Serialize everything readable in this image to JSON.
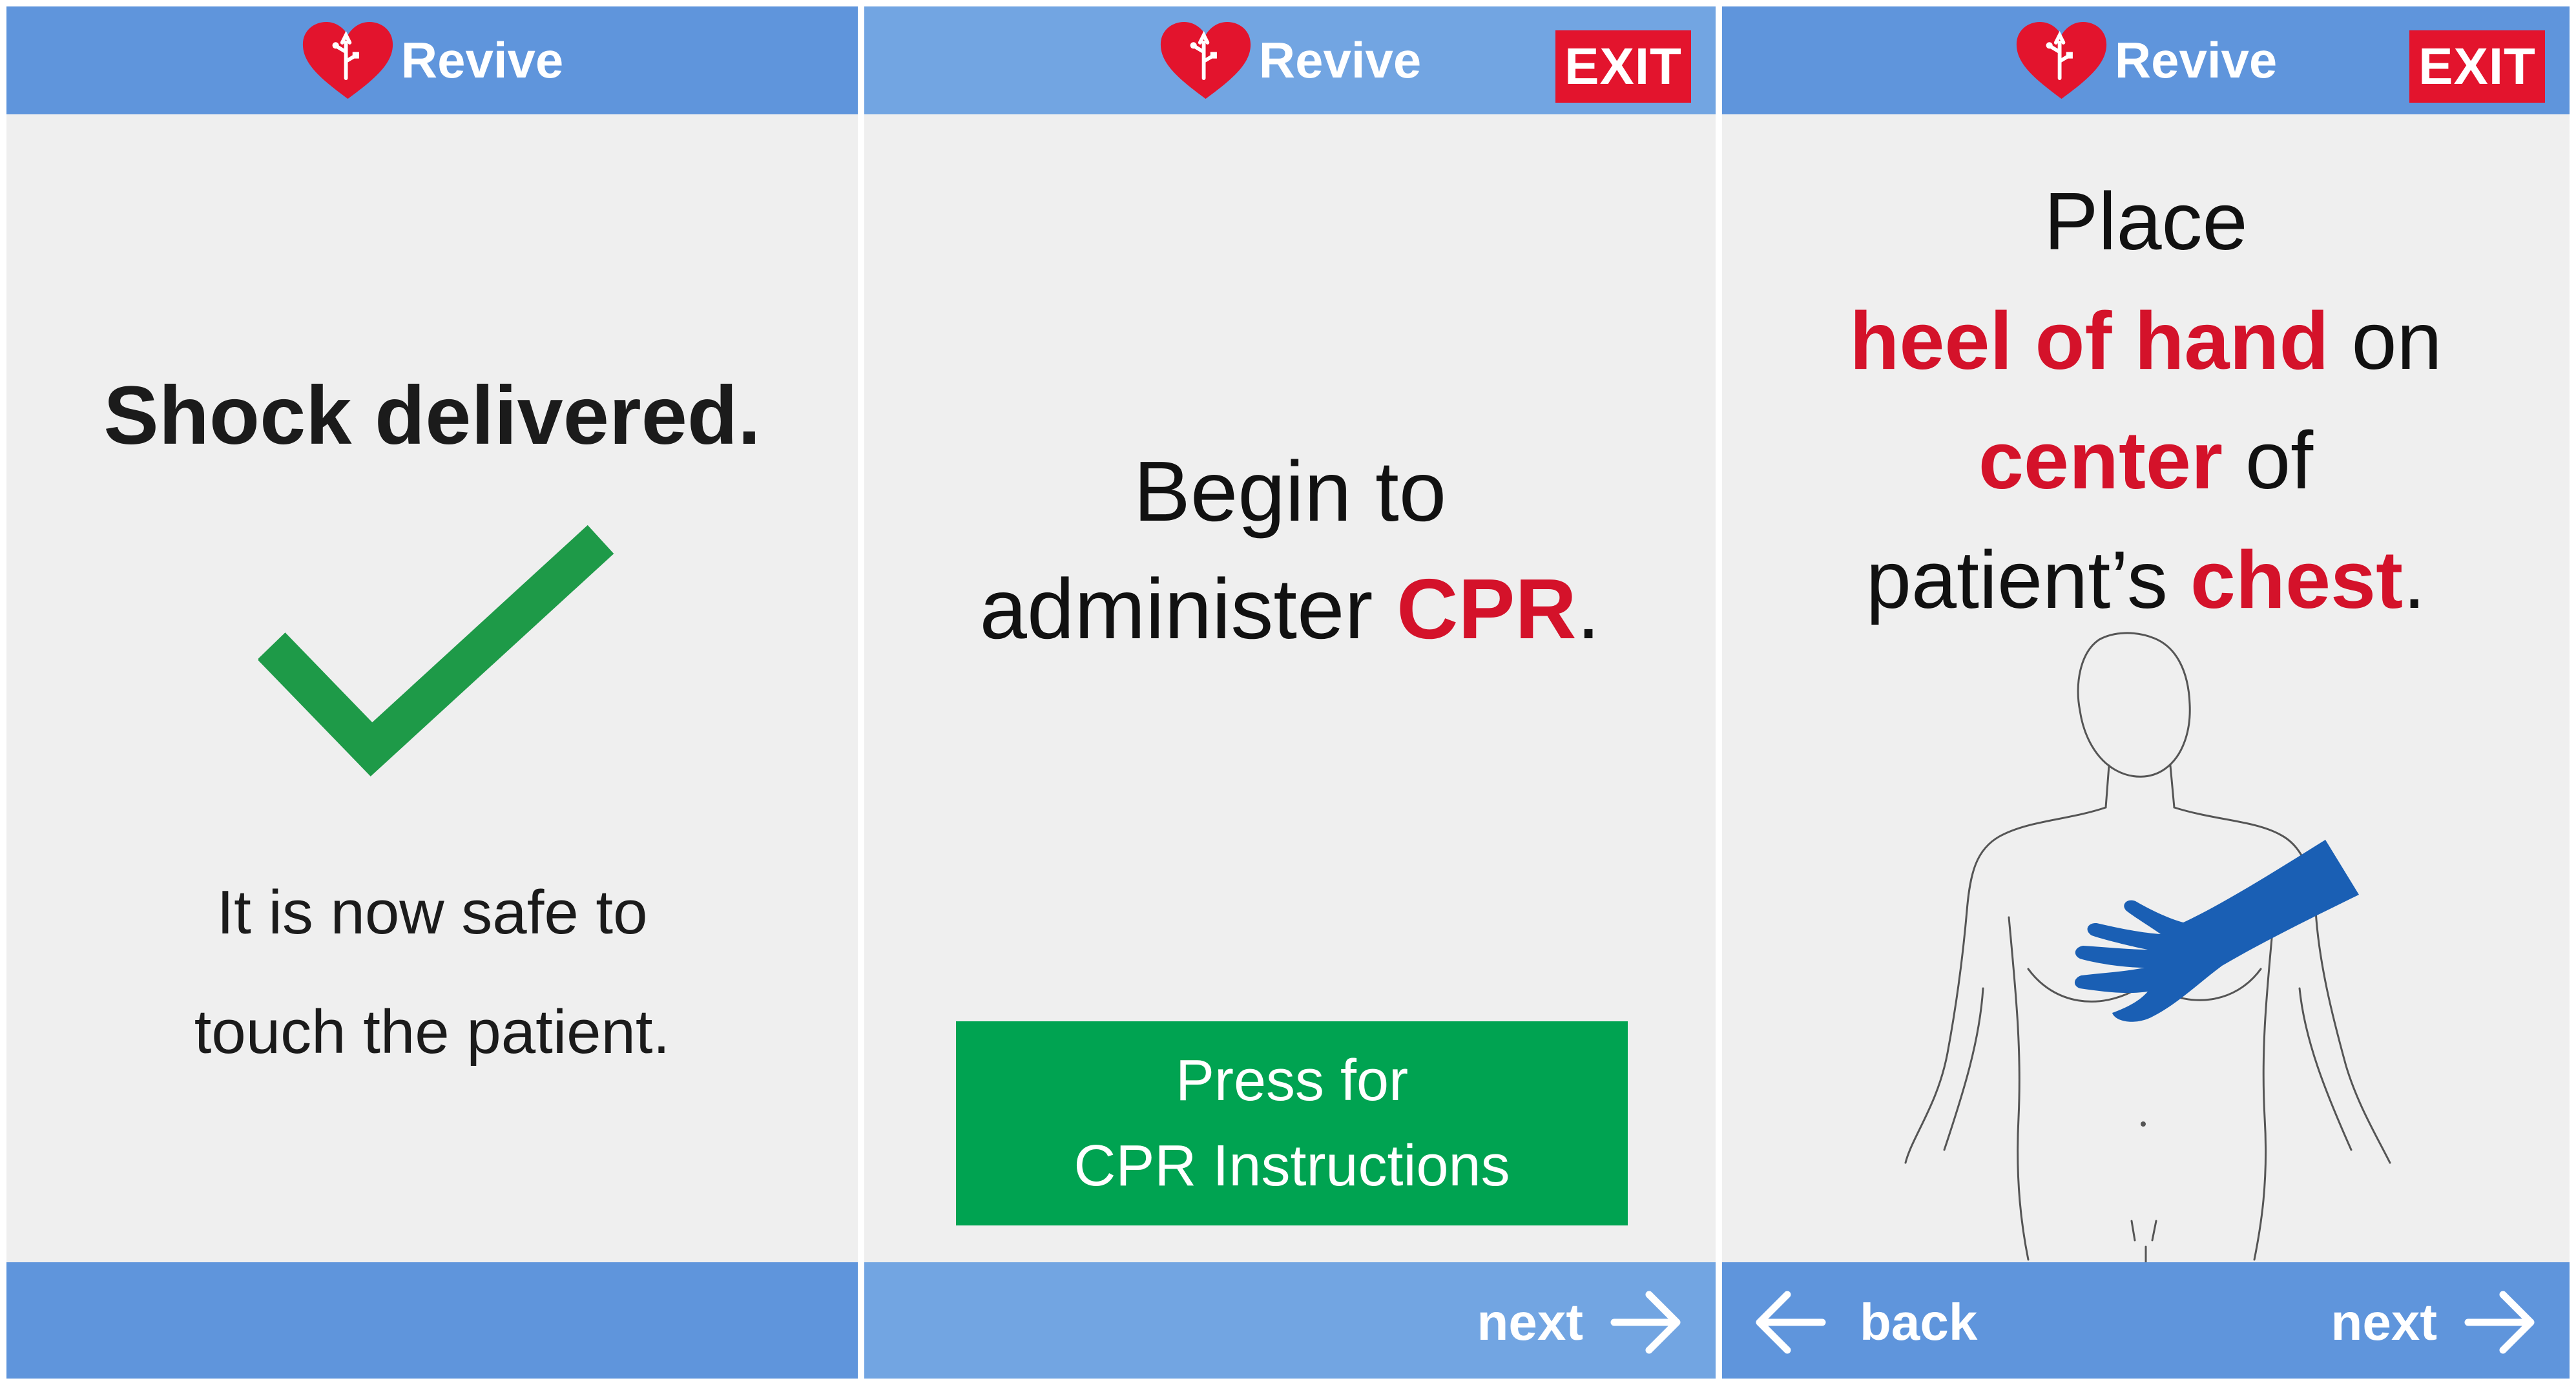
{
  "app": {
    "name": "Revive"
  },
  "colors": {
    "header": "#5f95dc",
    "exit": "#e3142d",
    "accent_red": "#d4122a",
    "button_green": "#00a351",
    "check_green": "#1e9a48",
    "hand_blue": "#1a5fb4"
  },
  "screen1": {
    "title": "Shock delivered.",
    "message_line1": "It is now safe to",
    "message_line2": "touch the patient.",
    "icon": "checkmark-icon"
  },
  "screen2": {
    "exit_label": "EXIT",
    "line1": "Begin to",
    "line2_prefix": "administer ",
    "line2_highlight": "CPR",
    "line2_suffix": ".",
    "button_line1": "Press for",
    "button_line2": "CPR Instructions",
    "next_label": "next"
  },
  "screen3": {
    "exit_label": "EXIT",
    "line1": "Place",
    "line2_highlight": "heel of hand",
    "line2_suffix": " on",
    "line3_highlight": "center",
    "line3_suffix": " of",
    "line4_prefix": "patient’s ",
    "line4_highlight": "chest",
    "line4_suffix": ".",
    "back_label": "back",
    "next_label": "next"
  }
}
